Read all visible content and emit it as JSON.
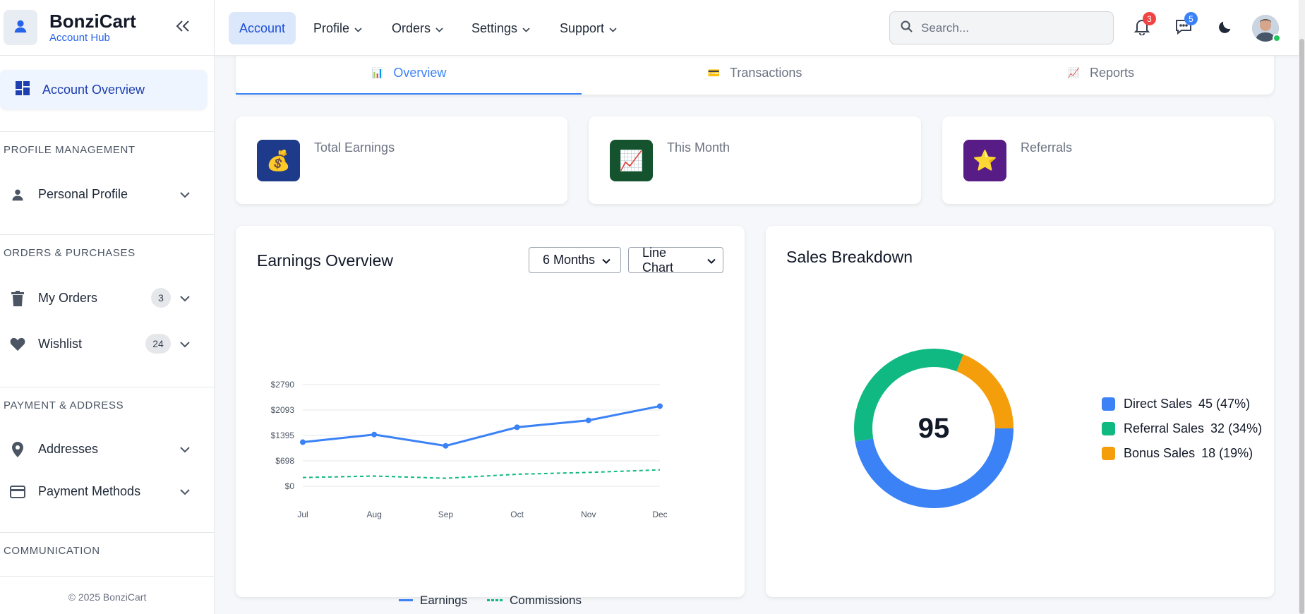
{
  "brand": {
    "title": "BonziCart",
    "subtitle": "Account Hub"
  },
  "sidebar": {
    "active_item": "Account Overview",
    "sections": [
      {
        "title": "PROFILE MANAGEMENT",
        "items": [
          {
            "label": "Personal Profile",
            "icon": "person-icon"
          }
        ]
      },
      {
        "title": "ORDERS & PURCHASES",
        "items": [
          {
            "label": "My Orders",
            "icon": "trash-icon",
            "badge": "3"
          },
          {
            "label": "Wishlist",
            "icon": "heart-icon",
            "badge": "24"
          }
        ]
      },
      {
        "title": "PAYMENT & ADDRESS",
        "items": [
          {
            "label": "Addresses",
            "icon": "map-pin-icon"
          },
          {
            "label": "Payment Methods",
            "icon": "credit-card-icon"
          }
        ]
      },
      {
        "title": "COMMUNICATION",
        "items": []
      }
    ],
    "footer": "© 2025 BonziCart"
  },
  "topbar": {
    "menu": [
      "Account",
      "Profile",
      "Orders",
      "Settings",
      "Support"
    ],
    "search_placeholder": "Search...",
    "notifications_count": "3",
    "messages_count": "5"
  },
  "tabs": [
    {
      "label": "Overview",
      "icon": "📊"
    },
    {
      "label": "Transactions",
      "icon": "💳"
    },
    {
      "label": "Reports",
      "icon": "📈"
    }
  ],
  "stats": [
    {
      "label": "Total Earnings",
      "icon": "💰",
      "color": "#1e3a8a"
    },
    {
      "label": "This Month",
      "icon": "📈",
      "color": "#14532d"
    },
    {
      "label": "Referrals",
      "icon": "⭐",
      "color": "#581c87"
    }
  ],
  "earnings": {
    "title": "Earnings Overview",
    "range_select": "6 Months",
    "type_select": "Line Chart"
  },
  "sales": {
    "title": "Sales Breakdown",
    "total": "95",
    "legend": [
      {
        "label": "Direct Sales",
        "value": "45 (47%)",
        "color": "#3b82f6"
      },
      {
        "label": "Referral Sales",
        "value": "32 (34%)",
        "color": "#10b981"
      },
      {
        "label": "Bonus Sales",
        "value": "18 (19%)",
        "color": "#f59e0b"
      }
    ]
  },
  "chart_data": [
    {
      "type": "line",
      "title": "Earnings Overview",
      "categories": [
        "Jul",
        "Aug",
        "Sep",
        "Oct",
        "Nov",
        "Dec"
      ],
      "y_ticks": [
        "$0",
        "$698",
        "$1395",
        "$2093",
        "$2790"
      ],
      "ylim": [
        0,
        2790
      ],
      "series": [
        {
          "name": "Earnings",
          "color": "#3b82f6",
          "style": "solid",
          "markers": true,
          "values": [
            1210,
            1420,
            1110,
            1620,
            1810,
            2200
          ]
        },
        {
          "name": "Commissions",
          "color": "#10b981",
          "style": "dashed",
          "markers": false,
          "values": [
            240,
            280,
            220,
            330,
            380,
            450
          ]
        }
      ],
      "legend": "bottom"
    },
    {
      "type": "pie",
      "title": "Sales Breakdown",
      "categories": [
        "Direct Sales",
        "Referral Sales",
        "Bonus Sales"
      ],
      "values": [
        45,
        32,
        18
      ],
      "colors": [
        "#3b82f6",
        "#10b981",
        "#f59e0b"
      ],
      "center_label": "95",
      "legend": "right"
    }
  ]
}
